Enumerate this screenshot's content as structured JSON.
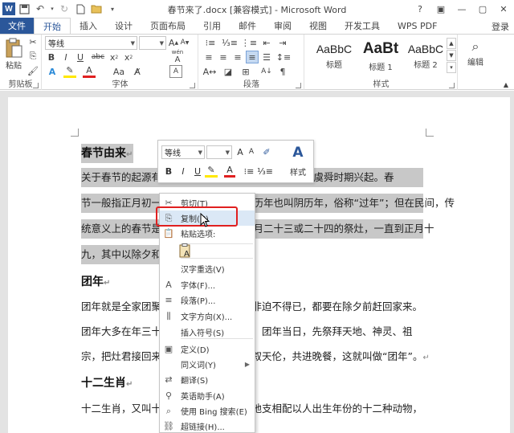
{
  "window": {
    "title": "春节来了.docx [兼容模式] - Microsoft Word",
    "logo": "W",
    "controls": [
      "?",
      "▣",
      "—",
      "▢",
      "✕"
    ]
  },
  "ribbon_tabs": {
    "file": "文件",
    "items": [
      "开始",
      "插入",
      "设计",
      "页面布局",
      "引用",
      "邮件",
      "审阅",
      "视图",
      "开发工具",
      "WPS PDF"
    ],
    "login": "登录"
  },
  "ribbon": {
    "clipboard": {
      "label": "剪贴板",
      "paste": "粘贴"
    },
    "font": {
      "label": "字体",
      "font_name": "等线",
      "wen": "wén",
      "wen_char": "A"
    },
    "paragraph": {
      "label": "段落"
    },
    "styles": {
      "label": "样式",
      "items": [
        {
          "preview": "AaBbC",
          "name": "标题"
        },
        {
          "preview": "AaBt",
          "name": "标题 1"
        },
        {
          "preview": "AaBbC",
          "name": "标题 2"
        }
      ]
    },
    "edit": {
      "label": "编辑"
    }
  },
  "document": {
    "lines": [
      {
        "text": "春节由来",
        "kind": "heading",
        "highlight": true
      },
      {
        "text": "关于春节的起源有",
        "tail": "一般认为春节由虞舜时期兴起。春",
        "kind": "body",
        "highlight": true
      },
      {
        "text": "节一般指正月初一",
        "tail": "农历年也叫阴历年，俗称“过年”；但在民间，传",
        "kind": "body",
        "highlight": true
      },
      {
        "text": "统意义上的春节是",
        "tail": "腊月二十三或二十四的祭灶，一直到正月十",
        "kind": "body",
        "highlight": true
      },
      {
        "text": "九，其中以除夕和",
        "tail": "",
        "kind": "body",
        "highlight": true
      },
      {
        "text": "团年",
        "kind": "heading",
        "highlight": false
      },
      {
        "text": "团年就是全家团聚",
        "tail": "，非迫不得已，都要在除夕前赶回家来。",
        "kind": "body",
        "highlight": false
      },
      {
        "text": "团年大多在年三十",
        "tail": "的，团年当日，先祭拜天地、神灵、祖",
        "kind": "body",
        "highlight": false
      },
      {
        "text": "宗，把灶君接回来",
        "tail": "欢叙天伦，共进晚餐，这就叫做“团年”。",
        "kind": "body",
        "highlight": false
      },
      {
        "text": "十二生肖",
        "kind": "heading",
        "highlight": false
      },
      {
        "text": "十二生肖，又叫十",
        "tail": "土地支相配以人出生年份的十二种动物，",
        "kind": "body",
        "highlight": false
      }
    ],
    "para_mark": "↵"
  },
  "mini_toolbar": {
    "font_name": "等线",
    "font_size": "",
    "style_label": "样式",
    "buttons": [
      "B",
      "I",
      "U"
    ]
  },
  "context_menu": {
    "items": [
      {
        "label": "剪切(T)",
        "icon": "✂",
        "icon_name": "cut-icon"
      },
      {
        "label": "复制(C)",
        "icon": "⎘",
        "icon_name": "copy-icon",
        "hover": true
      },
      {
        "label": "粘贴选项:",
        "icon": "📋",
        "icon_name": "paste-icon"
      },
      {
        "label": "汉字重选(V)",
        "icon": "",
        "icon_name": ""
      },
      {
        "label": "字体(F)...",
        "icon": "A",
        "icon_name": "font-icon"
      },
      {
        "label": "段落(P)...",
        "icon": "≡",
        "icon_name": "paragraph-icon"
      },
      {
        "label": "文字方向(X)...",
        "icon": "⫼",
        "icon_name": "text-direction-icon"
      },
      {
        "label": "插入符号(S)",
        "icon": "",
        "icon_name": ""
      },
      {
        "label": "定义(D)",
        "icon": "▣",
        "icon_name": "define-icon"
      },
      {
        "label": "同义词(Y)",
        "icon": "",
        "icon_name": "",
        "submenu": true
      },
      {
        "label": "翻译(S)",
        "icon": "⇄",
        "icon_name": "translate-icon"
      },
      {
        "label": "英语助手(A)",
        "icon": "⚲",
        "icon_name": "english-assistant-icon"
      },
      {
        "label": "使用 Bing 搜索(E)",
        "icon": "⌕",
        "icon_name": "bing-search-icon"
      },
      {
        "label": "超链接(H)...",
        "icon": "⛓",
        "icon_name": "hyperlink-icon"
      }
    ]
  },
  "colors": {
    "brand": "#2b579a",
    "selection": "#c8c8c8",
    "highlight_box": "#e02020",
    "menu_hover": "#dbe8f6"
  }
}
